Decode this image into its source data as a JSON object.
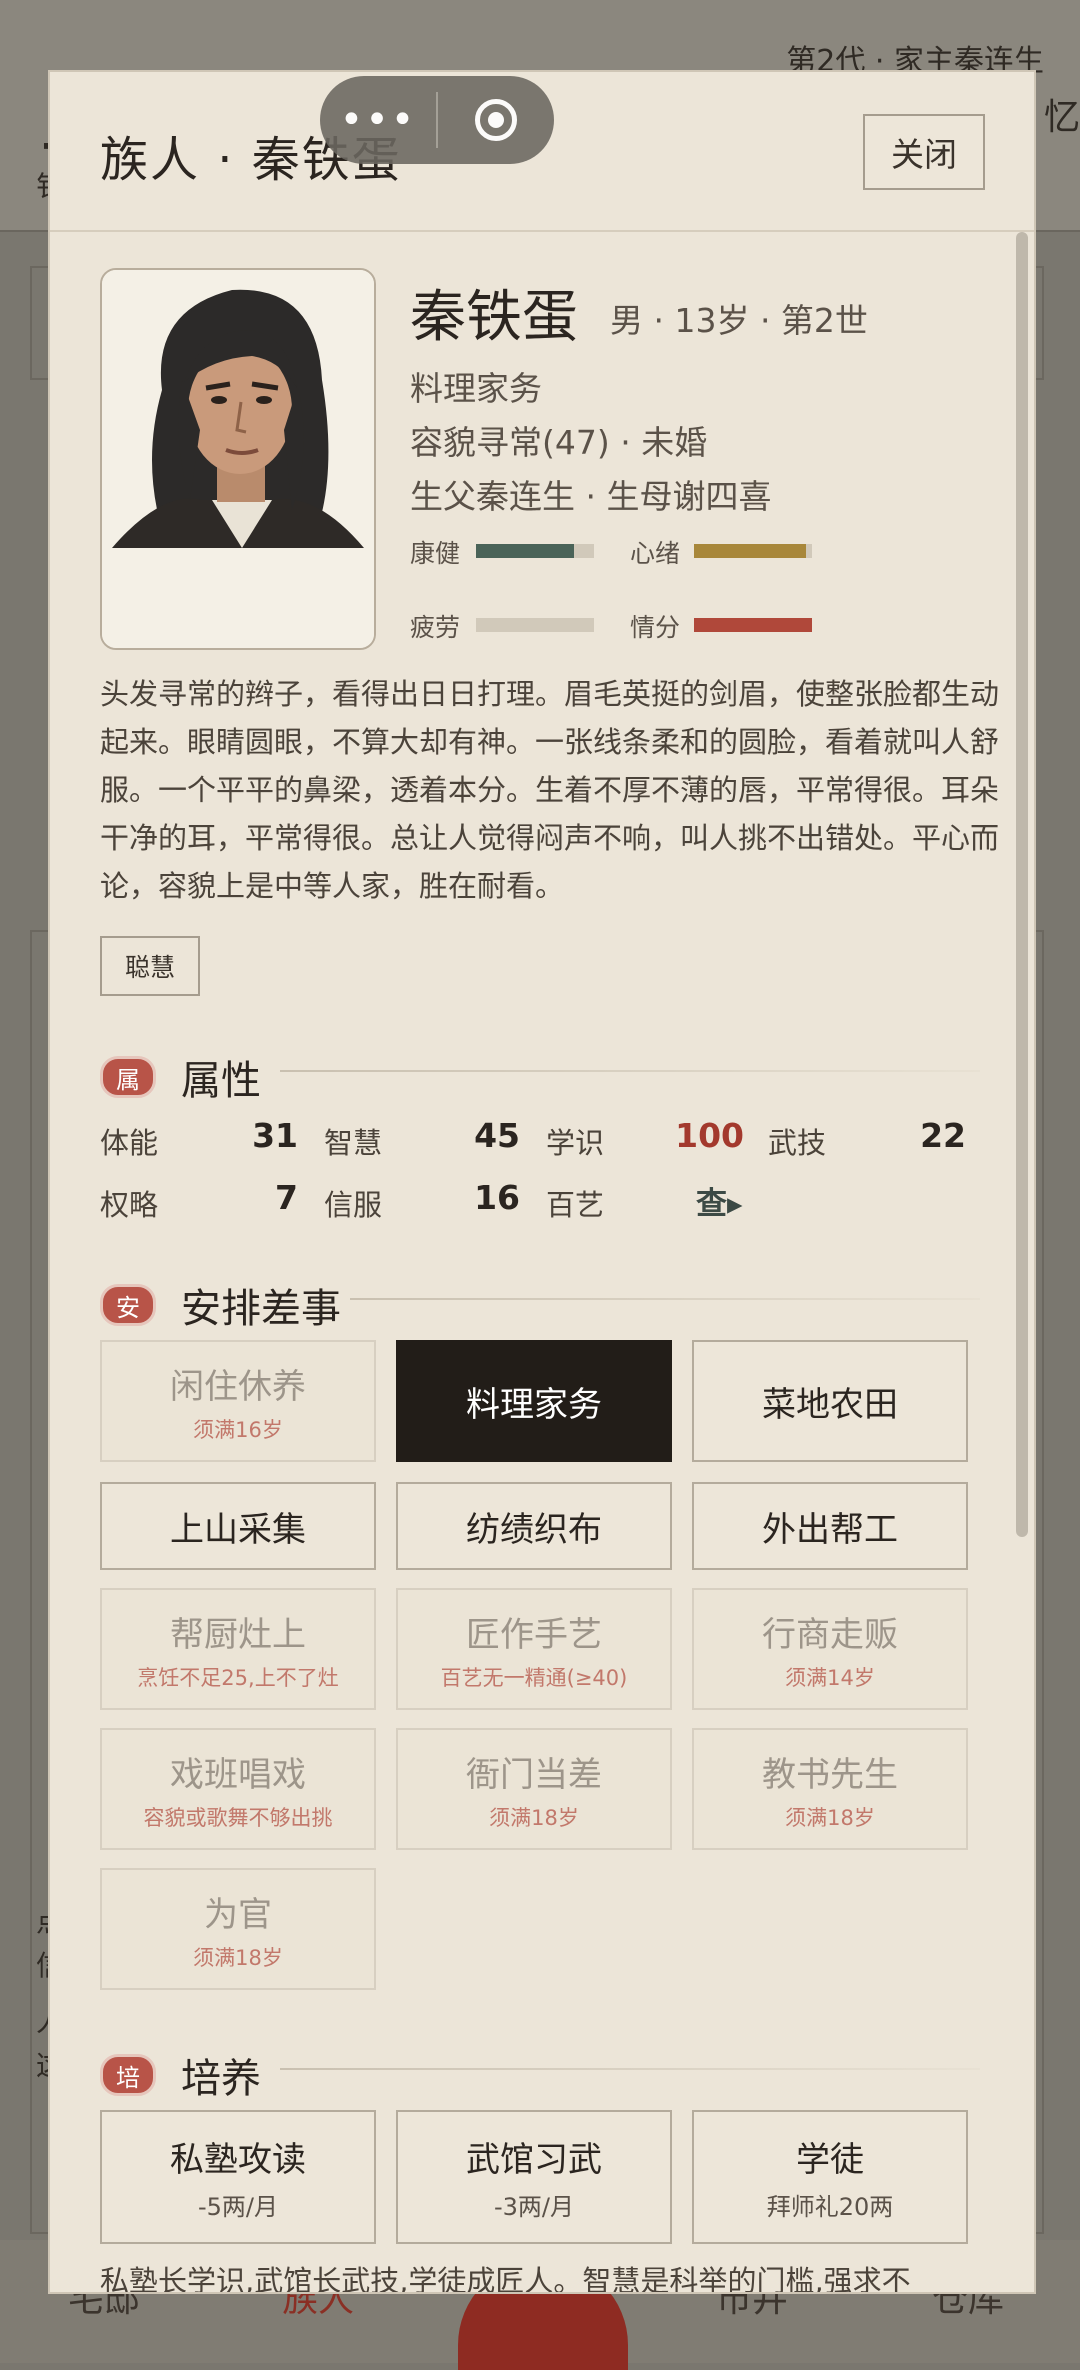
{
  "background": {
    "generation_line": "第2代 · 家主秦连生",
    "bottom_tabs": [
      "宅邸",
      "族人",
      "市井",
      "仓库"
    ]
  },
  "modal": {
    "title": "族人 · 秦铁蛋",
    "close_label": "关闭"
  },
  "capsule": {
    "more_icon": "more-dots-icon",
    "close_icon": "target-icon"
  },
  "profile": {
    "name": "秦铁蛋",
    "meta": "男 · 13岁 · 第2世",
    "job": "料理家务",
    "looks": "容貌寻常(47) · 未婚",
    "parents": "生父秦连生 · 生母谢四喜",
    "bars": [
      {
        "label": "康健",
        "level": 0.83,
        "color": "#4a6358"
      },
      {
        "label": "心绪",
        "level": 0.95,
        "color": "#a8873a"
      },
      {
        "label": "疲劳",
        "level": 0.0,
        "color": "#d1c9ba"
      },
      {
        "label": "情分",
        "level": 1.0,
        "color": "#b0483a"
      }
    ],
    "description": "头发寻常的辫子，看得出日日打理。眉毛英挺的剑眉，使整张脸都生动起来。眼睛圆眼，不算大却有神。一张线条柔和的圆脸，看着就叫人舒服。一个平平的鼻梁，透着本分。生着不厚不薄的唇，平常得很。耳朵干净的耳，平常得很。总让人觉得闷声不响，叫人挑不出错处。平心而论，容貌上是中等人家，胜在耐看。",
    "tag": "聪慧"
  },
  "attributes": {
    "badge": "属",
    "title": "属性",
    "items": [
      {
        "label": "体能",
        "value": "31"
      },
      {
        "label": "智慧",
        "value": "45"
      },
      {
        "label": "学识",
        "value": "100"
      },
      {
        "label": "武技",
        "value": "22"
      },
      {
        "label": "权略",
        "value": "7"
      },
      {
        "label": "信服",
        "value": "16"
      },
      {
        "label": "百艺",
        "value": "查▸"
      }
    ]
  },
  "jobs": {
    "badge": "安",
    "title": "安排差事",
    "options": [
      {
        "title": "闲住休养",
        "sub": "须满16岁"
      },
      {
        "title": "料理家务",
        "sub": ""
      },
      {
        "title": "菜地农田",
        "sub": ""
      },
      {
        "title": "上山采集",
        "sub": ""
      },
      {
        "title": "纺绩织布",
        "sub": ""
      },
      {
        "title": "外出帮工",
        "sub": ""
      },
      {
        "title": "帮厨灶上",
        "sub": "烹饪不足25,上不了灶"
      },
      {
        "title": "匠作手艺",
        "sub": "百艺无一精通(≥40)"
      },
      {
        "title": "行商走贩",
        "sub": "须满14岁"
      },
      {
        "title": "戏班唱戏",
        "sub": "容貌或歌舞不够出挑"
      },
      {
        "title": "衙门当差",
        "sub": "须满18岁"
      },
      {
        "title": "教书先生",
        "sub": "须满18岁"
      },
      {
        "title": "为官",
        "sub": "须满18岁"
      }
    ]
  },
  "training": {
    "badge": "培",
    "title": "培养",
    "options": [
      {
        "title": "私塾攻读",
        "sub": "-5两/月"
      },
      {
        "title": "武馆习武",
        "sub": "-3两/月"
      },
      {
        "title": "学徒",
        "sub": "拜师礼20两"
      }
    ],
    "note": "私塾长学识,武馆长武技,学徒成匠人。智慧是科举的门槛,强求不"
  }
}
